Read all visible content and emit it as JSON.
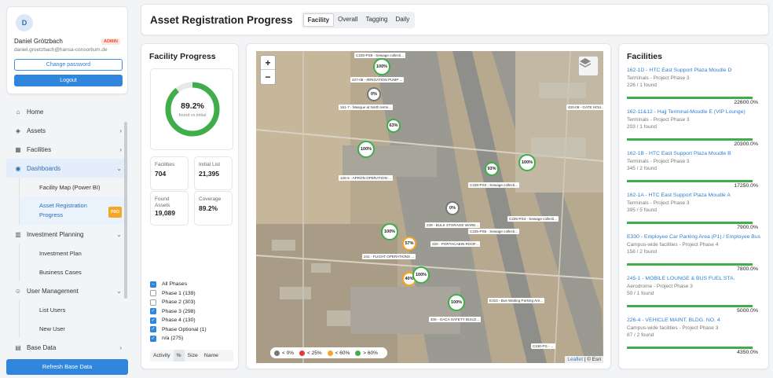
{
  "user": {
    "initial": "D",
    "name": "Daniel Grötzbach",
    "role": "ADMIN",
    "email": "daniel.groetzbach@hansa-consortium.de",
    "change_password": "Change password",
    "logout": "Logout"
  },
  "nav": {
    "home": "Home",
    "assets": "Assets",
    "facilities": "Facilities",
    "dashboards": "Dashboards",
    "facility_map": "Facility Map (Power BI)",
    "asset_registration": "Asset Registration Progress",
    "pro_badge": "PRO",
    "investment_planning": "Investment Planning",
    "investment_plan": "Investment Plan",
    "business_cases": "Business Cases",
    "user_management": "User Management",
    "list_users": "List Users",
    "new_user": "New User",
    "base_data": "Base Data",
    "refresh": "Refresh Base Data"
  },
  "header": {
    "title": "Asset Registration Progress",
    "tabs": [
      "Facility",
      "Overall",
      "Tagging",
      "Daily"
    ],
    "active_tab": "Facility"
  },
  "progress": {
    "title": "Facility Progress",
    "percent": "89.2%",
    "percent_value": 89.2,
    "subtitle": "found vs initial",
    "stats": [
      {
        "label": "Facilities",
        "value": "704"
      },
      {
        "label": "Initial List",
        "value": "21,395"
      },
      {
        "label": "Found Assets",
        "value": "19,089"
      },
      {
        "label": "Coverage",
        "value": "89.2%"
      }
    ],
    "phases": [
      {
        "label": "All Phases",
        "state": "partial"
      },
      {
        "label": "Phase 1 (139)",
        "state": "off"
      },
      {
        "label": "Phase 2 (303)",
        "state": "off"
      },
      {
        "label": "Phase 3 (298)",
        "state": "on"
      },
      {
        "label": "Phase 4 (130)",
        "state": "on"
      },
      {
        "label": "Phase Optional (1)",
        "state": "on"
      },
      {
        "label": "n/a (275)",
        "state": "on"
      }
    ],
    "sort": [
      "Activity",
      "%",
      "Size",
      "Name"
    ],
    "sort_active": "%"
  },
  "map": {
    "zoom_in": "+",
    "zoom_out": "−",
    "legend": [
      {
        "label": "< 0%",
        "color": "#777777"
      },
      {
        "label": "< 25%",
        "color": "#e53935"
      },
      {
        "label": "< 60%",
        "color": "#f5a623"
      },
      {
        "label": "> 60%",
        "color": "#3fae4a"
      }
    ],
    "attribution_link": "Leaflet",
    "attribution_rest": "| © Esri",
    "markers": [
      {
        "label": "100%",
        "color": "#3fae4a"
      },
      {
        "label": "0%",
        "color": "#777777"
      },
      {
        "label": "63%",
        "color": "#3fae4a"
      },
      {
        "label": "100%",
        "color": "#3fae4a"
      },
      {
        "label": "93%",
        "color": "#3fae4a"
      },
      {
        "label": "100%",
        "color": "#3fae4a"
      },
      {
        "label": "0%",
        "color": "#777777"
      },
      {
        "label": "100%",
        "color": "#3fae4a"
      },
      {
        "label": "57%",
        "color": "#f5a623"
      },
      {
        "label": "40%",
        "color": "#f5a623"
      },
      {
        "label": "100%",
        "color": "#3fae4a"
      },
      {
        "label": "100%",
        "color": "#3fae4a"
      }
    ],
    "labels": [
      "C225-PS8 - Sewage collecti...",
      "427-08 - IRRIGATION PUMP ...",
      "161-7 - Masque at North termi...",
      "420-09 - GATE HOU...",
      "C228-PS3 - Sewage collecti...",
      "C225-PS4 - Sewage collecti...",
      "239 - BULK STORAGE WARE...",
      "220 - PORTACABIN ROOF...",
      "241 - FLIGHT OPERATIONS ...",
      "C225-PS5 - Sewage collecti...",
      "E310 - Bus Waiting Parking Are...",
      "405 - GACA SAFETY BUILD...",
      "C230-PS - ...",
      "126-5 - APRON OPERATION ..."
    ]
  },
  "facilities": {
    "title": "Facilities",
    "items": [
      {
        "name": "162-1D - HTC East Support Plaza Moudle D",
        "category": "Terminals - Project Phase 3",
        "count": "226 / 1 found",
        "percent": "22600.0%"
      },
      {
        "name": "162-11&12 - Hajj Terminal-Moudle E (VIP Lounge)",
        "category": "Terminals - Project Phase 3",
        "count": "203 / 1 found",
        "percent": "20300.0%"
      },
      {
        "name": "162-1B - HTC East Support Plaza Moudle B",
        "category": "Terminals - Project Phase 3",
        "count": "345 / 2 found",
        "percent": "17250.0%"
      },
      {
        "name": "162-1A - HTC East Support Plaza Moudle A",
        "category": "Terminals - Project Phase 3",
        "count": "395 / 5 found",
        "percent": "7900.0%"
      },
      {
        "name": "E330 - Employee Car Parking Area (P1) / Employee Bus...",
        "category": "Campus-wide facilities - Project Phase 4",
        "count": "156 / 2 found",
        "percent": "7800.0%"
      },
      {
        "name": "245-1 - MOBILE LOUNGE & BUS FUEL STA.",
        "category": "Aerodrome - Project Phase 3",
        "count": "50 / 1 found",
        "percent": "5000.0%"
      },
      {
        "name": "226-4 - VEHICLE MAINT. BLDG. NO. 4",
        "category": "Campus-wide facilities - Project Phase 3",
        "count": "87 / 2 found",
        "percent": "4350.0%"
      }
    ]
  }
}
